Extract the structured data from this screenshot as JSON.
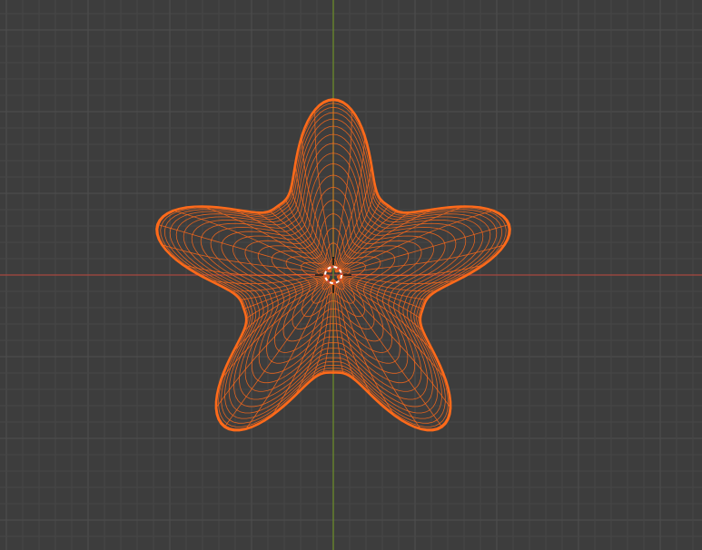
{
  "viewport": {
    "view": "top-orthographic",
    "grid": "on",
    "selected_object": "star-mesh",
    "selection_mode": "wireframe",
    "colors": {
      "background": "#3d3d3d",
      "grid_minor": "#474747",
      "grid_major": "#4e4e4e",
      "x_axis": "#a8473f",
      "y_axis": "#6a8b2b",
      "selection": "#ff6a1a",
      "cursor": "#ffffff",
      "cursor_ring": "#d24a3a"
    },
    "icons": [
      "3d-cursor-icon"
    ]
  }
}
